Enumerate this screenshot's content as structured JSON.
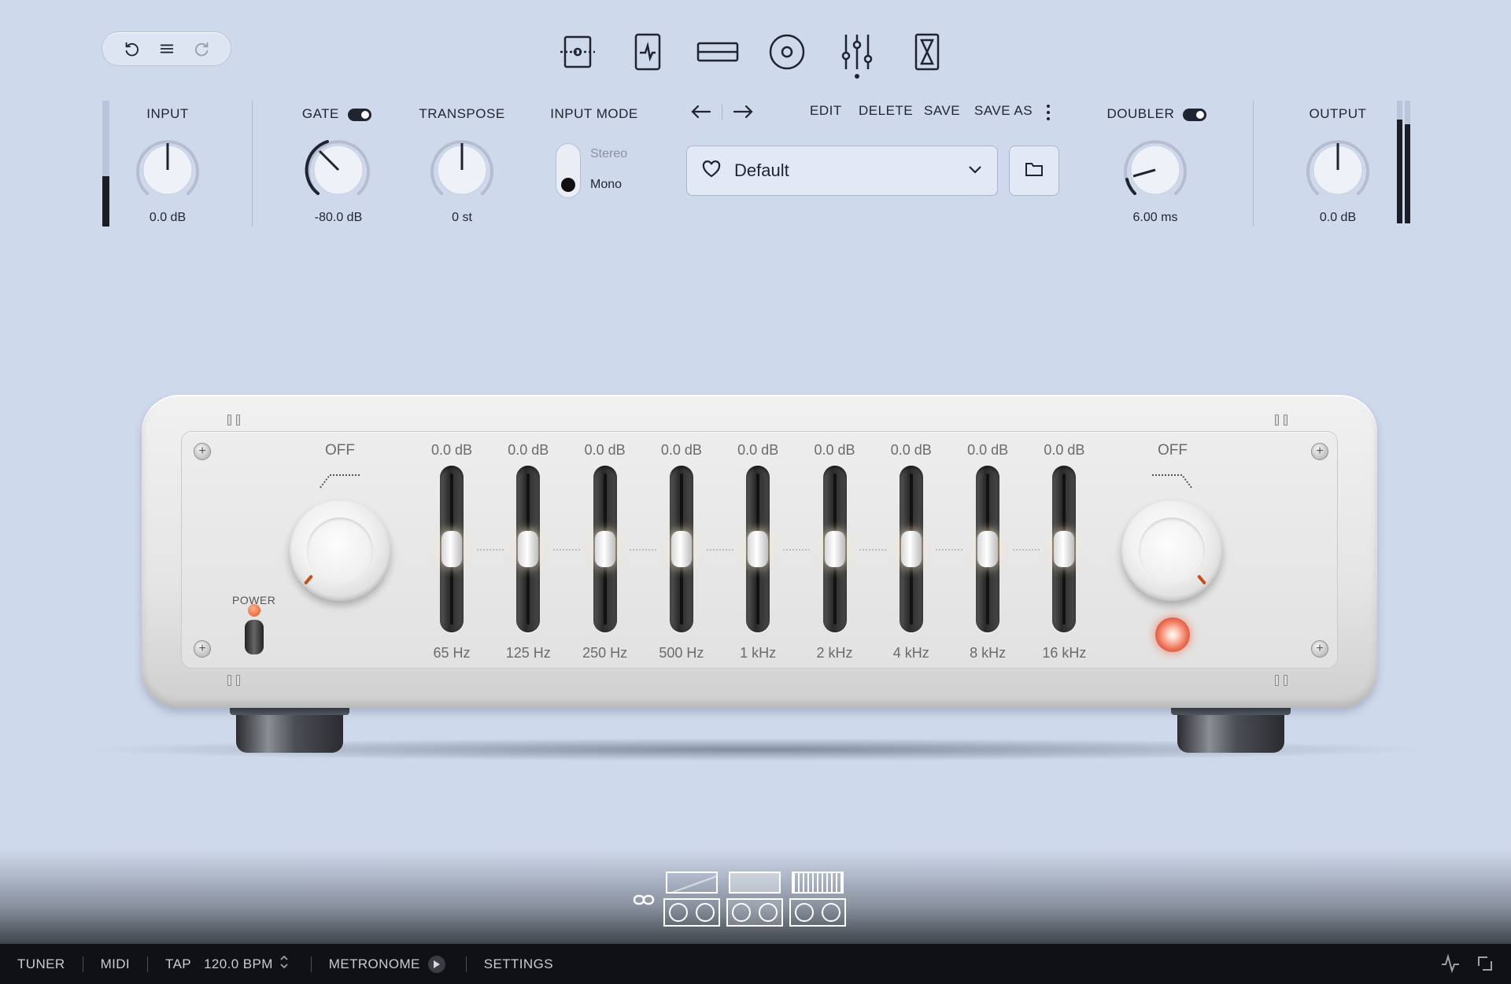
{
  "toolbar": {
    "undo_icon": "undo-icon",
    "menu_icon": "menu-icon",
    "redo_icon": "redo-icon",
    "nav": [
      {
        "icon": "signal-flow-icon"
      },
      {
        "icon": "tuner-device-icon"
      },
      {
        "icon": "rack-icon"
      },
      {
        "icon": "cabinet-speaker-icon"
      },
      {
        "icon": "mixer-sliders-icon",
        "active": true
      },
      {
        "icon": "hourglass-icon"
      }
    ]
  },
  "controls": {
    "input": {
      "label": "INPUT",
      "value": "0.0 dB",
      "meter_level": 0.4
    },
    "gate": {
      "label": "GATE",
      "value": "-80.0 dB",
      "enabled": true
    },
    "transpose": {
      "label": "TRANSPOSE",
      "value": "0 st"
    },
    "input_mode": {
      "label": "INPUT MODE",
      "options": [
        "Stereo",
        "Mono"
      ],
      "selected": "Mono"
    },
    "doubler": {
      "label": "DOUBLER",
      "value": "6.00 ms",
      "enabled": true
    },
    "output": {
      "label": "OUTPUT",
      "value": "0.0 dB",
      "meter_level": 0.8
    }
  },
  "preset": {
    "edit": "EDIT",
    "delete": "DELETE",
    "save": "SAVE",
    "save_as": "SAVE AS",
    "name": "Default",
    "favorite_icon": "heart-icon",
    "folder_icon": "folder-icon"
  },
  "eq": {
    "low_cut_label": "OFF",
    "high_cut_label": "OFF",
    "power_label": "POWER",
    "bands": [
      {
        "gain": "0.0 dB",
        "freq": "65 Hz"
      },
      {
        "gain": "0.0 dB",
        "freq": "125 Hz"
      },
      {
        "gain": "0.0 dB",
        "freq": "250 Hz"
      },
      {
        "gain": "0.0 dB",
        "freq": "500 Hz"
      },
      {
        "gain": "0.0 dB",
        "freq": "1 kHz"
      },
      {
        "gain": "0.0 dB",
        "freq": "2 kHz"
      },
      {
        "gain": "0.0 dB",
        "freq": "4 kHz"
      },
      {
        "gain": "0.0 dB",
        "freq": "8 kHz"
      },
      {
        "gain": "0.0 dB",
        "freq": "16 kHz"
      }
    ]
  },
  "chain": {
    "link_icon": "link-icon",
    "modules": 3
  },
  "statusbar": {
    "tuner": "TUNER",
    "midi": "MIDI",
    "tap": "TAP",
    "bpm": "120.0 BPM",
    "metronome": "METRONOME",
    "settings": "SETTINGS"
  }
}
